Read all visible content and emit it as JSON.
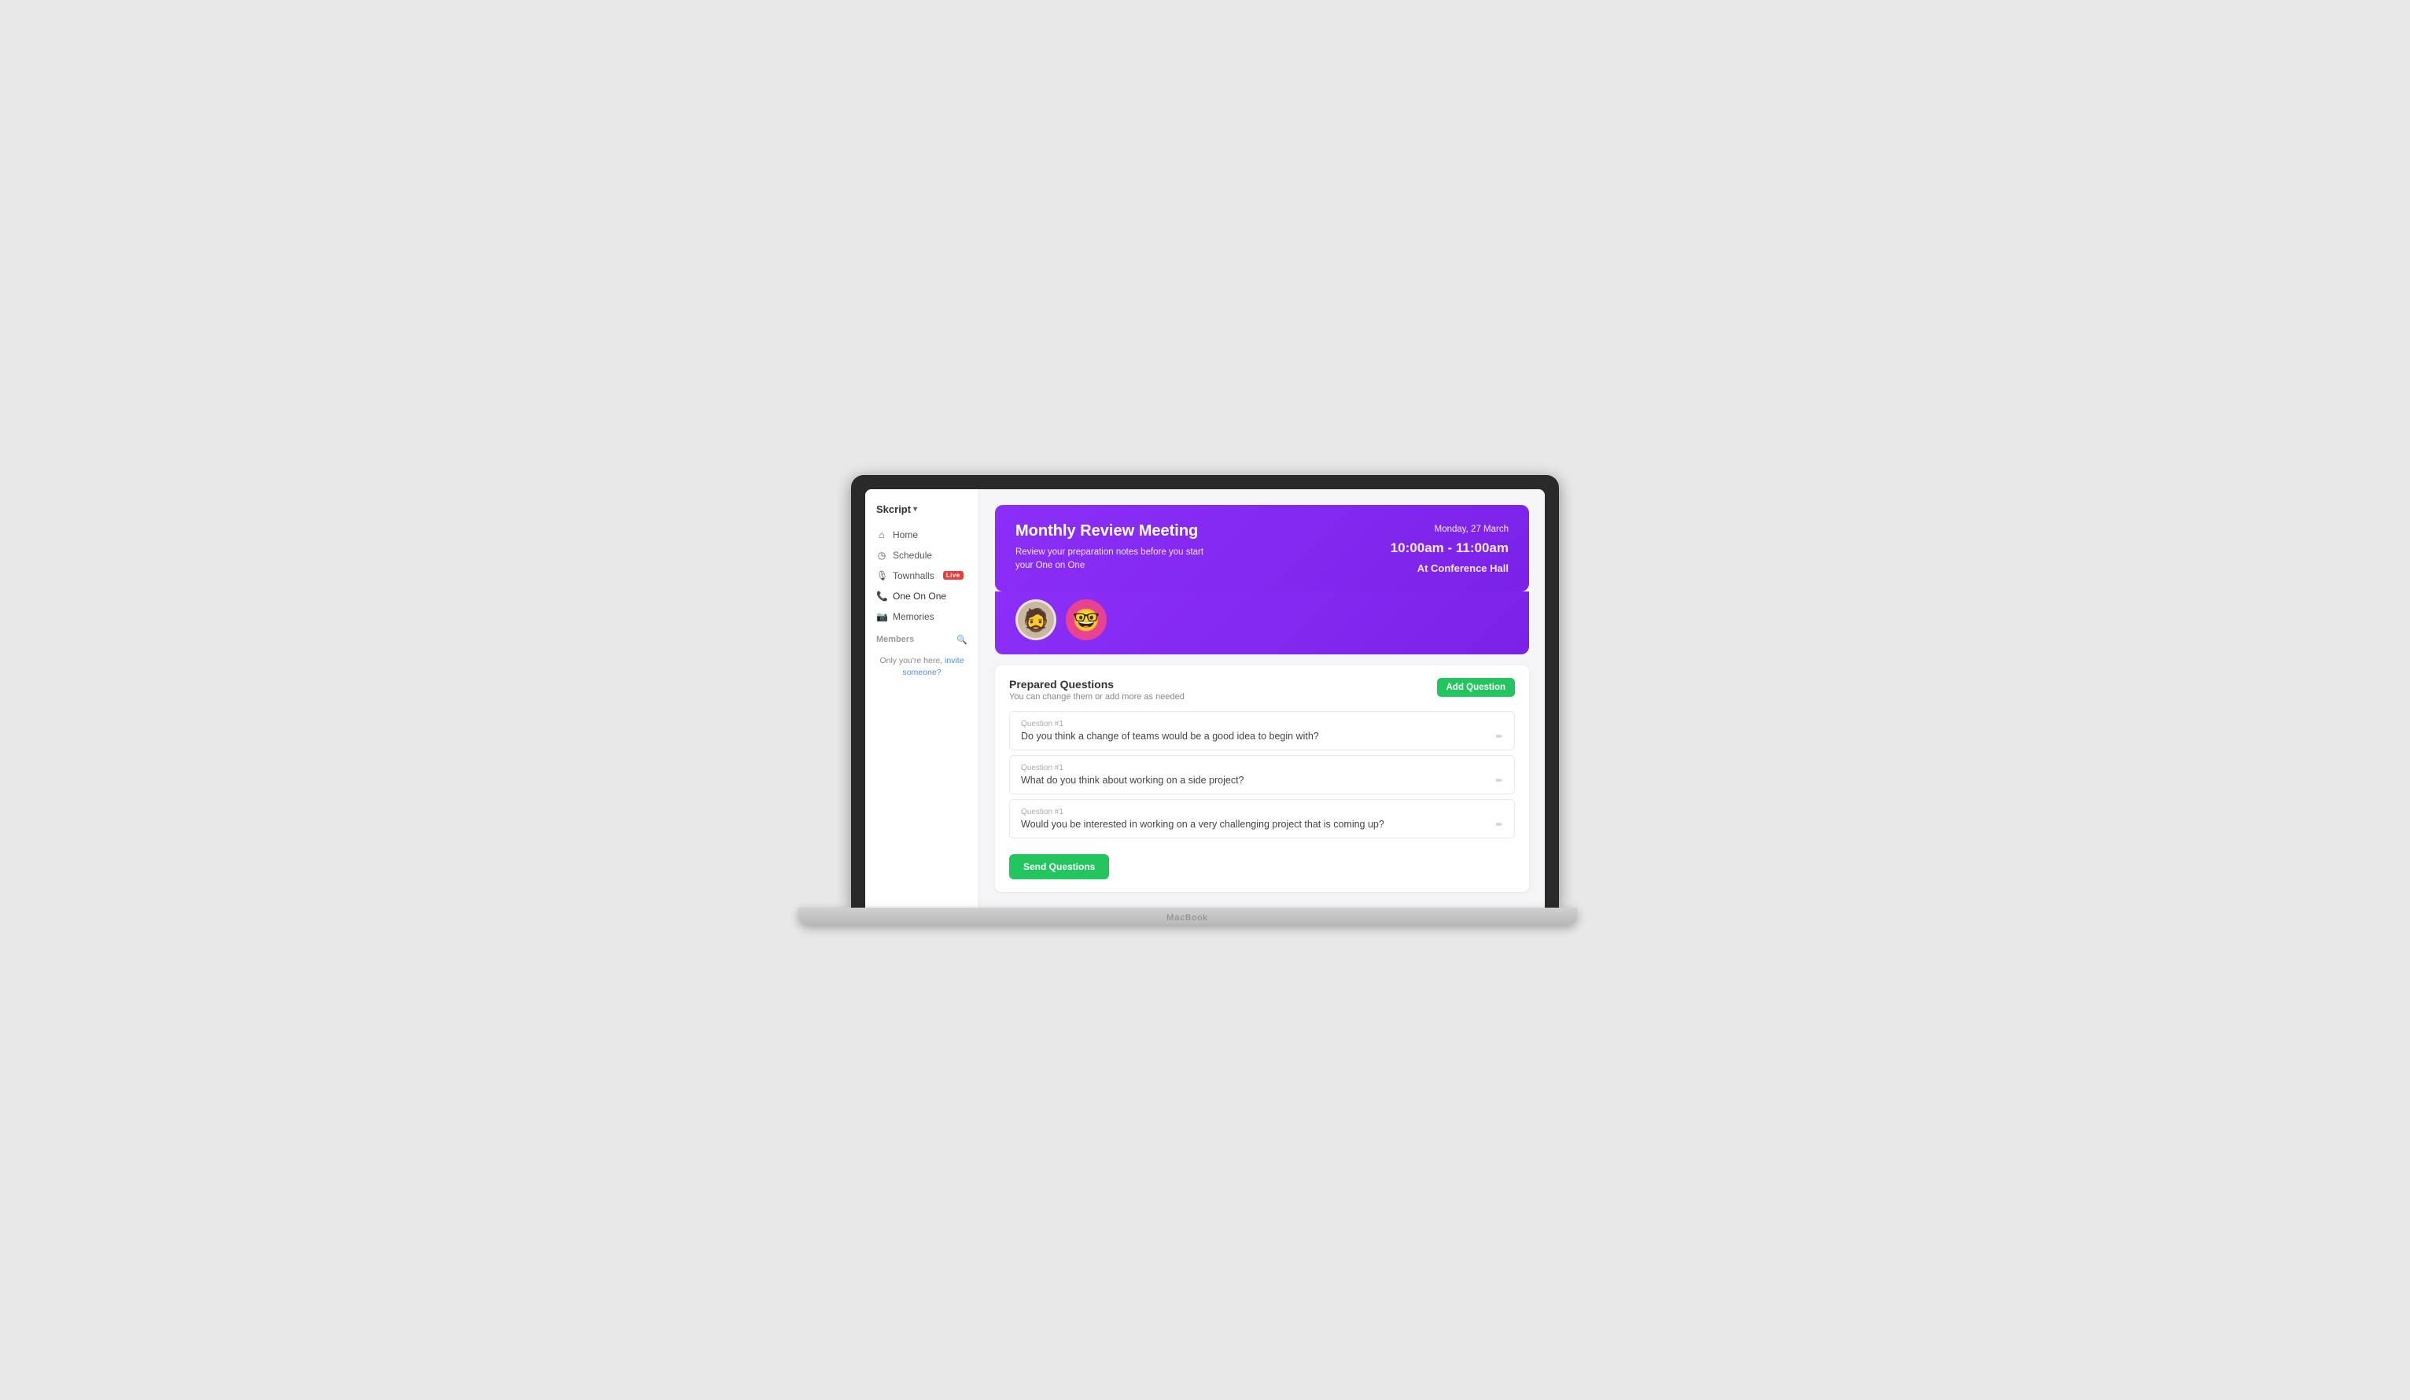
{
  "brand": {
    "name": "Skcript",
    "chevron": "▾"
  },
  "sidebar": {
    "nav_items": [
      {
        "id": "home",
        "label": "Home",
        "icon": "⌂",
        "active": false,
        "badge": null
      },
      {
        "id": "schedule",
        "label": "Schedule",
        "icon": "◷",
        "active": false,
        "badge": null
      },
      {
        "id": "townhalls",
        "label": "Townhalls",
        "icon": "🎙",
        "active": false,
        "badge": "Live"
      },
      {
        "id": "one-on-one",
        "label": "One On One",
        "icon": "📞",
        "active": true,
        "badge": null
      },
      {
        "id": "memories",
        "label": "Memories",
        "icon": "📷",
        "active": false,
        "badge": null
      }
    ],
    "members_section": "Members",
    "members_empty_text": "Only you're here,",
    "members_invite_link": "invite someone?"
  },
  "meeting": {
    "title": "Monthly Review Meeting",
    "subtitle_line1": "Review your preparation notes before you start",
    "subtitle_line2": "your One on One",
    "date": "Monday, 27 March",
    "time_range": "10:00am - 11:00am",
    "location": "At Conference Hall"
  },
  "questions_section": {
    "title": "Prepared Questions",
    "subtitle": "You can change them or add more as needed",
    "add_button_label": "Add Question",
    "questions": [
      {
        "label": "Question #1",
        "text": "Do you think a change of teams would be a good idea to begin with?"
      },
      {
        "label": "Question #1",
        "text": "What do you think about working on a side project?"
      },
      {
        "label": "Question #1",
        "text": "Would you be interested in working on a very challenging project that is coming up?"
      }
    ],
    "send_button_label": "Send Questions"
  },
  "macbook_label": "MacBook"
}
